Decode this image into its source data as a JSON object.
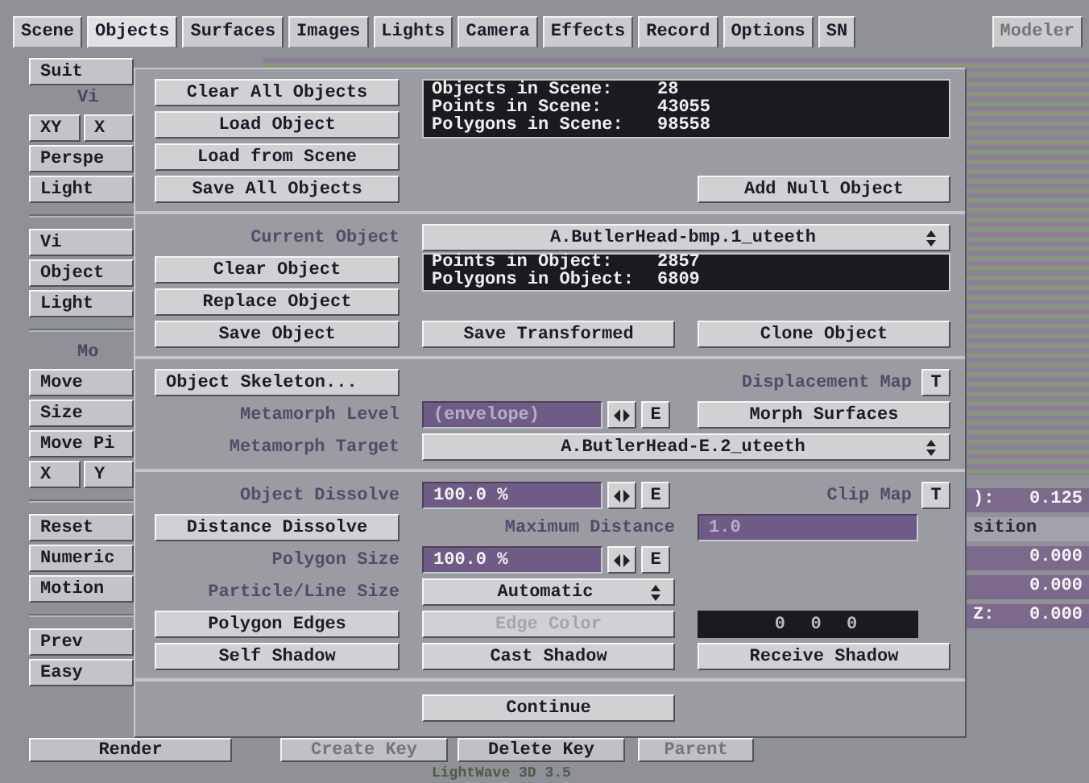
{
  "tabs": [
    {
      "label": "Scene",
      "selected": false
    },
    {
      "label": "Objects",
      "selected": true
    },
    {
      "label": "Surfaces",
      "selected": false
    },
    {
      "label": "Images",
      "selected": false
    },
    {
      "label": "Lights",
      "selected": false
    },
    {
      "label": "Camera",
      "selected": false
    },
    {
      "label": "Effects",
      "selected": false
    },
    {
      "label": "Record",
      "selected": false
    },
    {
      "label": "Options",
      "selected": false
    },
    {
      "label": "SN",
      "selected": false
    }
  ],
  "modeler_button": {
    "label": "Modeler",
    "disabled": true
  },
  "left_panel": [
    {
      "kind": "button",
      "labels": [
        "Suit"
      ]
    },
    {
      "kind": "label",
      "labels": [
        "Vi"
      ]
    },
    {
      "kind": "button",
      "labels": [
        "XY",
        "X"
      ]
    },
    {
      "kind": "button",
      "labels": [
        "Perspe"
      ]
    },
    {
      "kind": "button",
      "labels": [
        "Light"
      ]
    },
    {
      "kind": "divider"
    },
    {
      "kind": "button",
      "labels": [
        "Vi"
      ]
    },
    {
      "kind": "button",
      "labels": [
        "Object"
      ]
    },
    {
      "kind": "button",
      "labels": [
        "Light"
      ]
    },
    {
      "kind": "divider"
    },
    {
      "kind": "label",
      "labels": [
        "Mo"
      ]
    },
    {
      "kind": "button",
      "labels": [
        "Move"
      ]
    },
    {
      "kind": "button",
      "labels": [
        "Size"
      ]
    },
    {
      "kind": "button",
      "labels": [
        "Move Pi"
      ]
    },
    {
      "kind": "button",
      "labels": [
        "X",
        "Y"
      ]
    },
    {
      "kind": "divider"
    },
    {
      "kind": "button",
      "labels": [
        "Reset"
      ]
    },
    {
      "kind": "button",
      "labels": [
        "Numeric"
      ]
    },
    {
      "kind": "button",
      "labels": [
        "Motion"
      ]
    },
    {
      "kind": "divider"
    },
    {
      "kind": "button",
      "labels": [
        "Prev"
      ]
    },
    {
      "kind": "button",
      "labels": [
        "Easy"
      ]
    }
  ],
  "readouts": [
    {
      "label": "):",
      "value": "0.125",
      "highlighted": true
    },
    {
      "label": "sition",
      "highlighted": false
    },
    {
      "value": "0.000",
      "highlighted": true
    },
    {
      "value": "0.000",
      "highlighted": true
    },
    {
      "label": "Z:",
      "value": "0.000",
      "highlighted": true
    }
  ],
  "dialog": {
    "scene": {
      "buttons": [
        "Clear All Objects",
        "Load Object",
        "Load from Scene",
        "Save All Objects"
      ],
      "stats": [
        {
          "label": "Objects in Scene:",
          "value": "28"
        },
        {
          "label": "Points in Scene:",
          "value": "43055"
        },
        {
          "label": "Polygons in Scene:",
          "value": "98558"
        }
      ],
      "add_null_button": "Add Null Object"
    },
    "object": {
      "current_object_label": "Current Object",
      "current_object": "A.ButlerHead-bmp.1_uteeth",
      "buttons": [
        "Clear Object",
        "Replace Object",
        "Save Object"
      ],
      "stats": [
        {
          "label": "Points in Object:",
          "value": "2857"
        },
        {
          "label": "Polygons in Object:",
          "value": "6809"
        }
      ],
      "save_transformed_button": "Save Transformed",
      "clone_button": "Clone Object"
    },
    "morph": {
      "skeleton_button": "Object Skeleton...",
      "displacement_label": "Displacement Map",
      "displacement_toggle": "T",
      "level_label": "Metamorph Level",
      "level_value": "(envelope)",
      "envelope_button": "E",
      "morph_surfaces_button": "Morph Surfaces",
      "target_label": "Metamorph Target",
      "target": "A.ButlerHead-E.2_uteeth"
    },
    "render": {
      "dissolve_label": "Object Dissolve",
      "dissolve_value": "100.0 %",
      "dissolve_envelope": "E",
      "clip_label": "Clip Map",
      "clip_toggle": "T",
      "distance_button": "Distance Dissolve",
      "max_distance_label": "Maximum Distance",
      "max_distance_value": "1.0",
      "polygon_size_label": "Polygon Size",
      "polygon_size_value": "100.0 %",
      "polygon_size_envelope": "E",
      "particle_label": "Particle/Line Size",
      "particle_value": "Automatic",
      "edges_button": "Polygon Edges",
      "edge_color_button": {
        "label": "Edge Color",
        "disabled": true
      },
      "edge_color_values": [
        "0",
        "0",
        "0"
      ],
      "shadow_buttons": [
        "Self Shadow",
        "Cast Shadow",
        "Receive Shadow"
      ]
    },
    "continue_button": "Continue"
  },
  "bottom_bar": [
    {
      "label": "Render",
      "disabled": false
    },
    {
      "label": "Create Key",
      "disabled": true
    },
    {
      "label": "Delete Key",
      "disabled": false
    },
    {
      "label": "Parent",
      "disabled": true
    }
  ],
  "version": "LightWave 3D 3.5"
}
